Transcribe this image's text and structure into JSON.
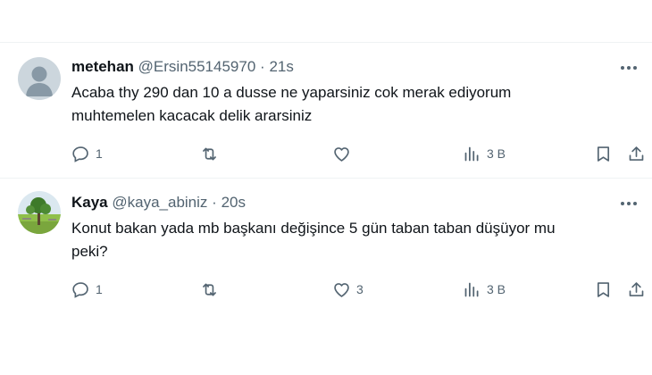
{
  "tweets": [
    {
      "name": "metehan",
      "handle": "@Ersin55145970",
      "separator": "·",
      "time": "21s",
      "text_line1": "Acaba thy 290 dan 10 a dusse ne yaparsiniz cok merak ediyorum",
      "text_line2": "muhtemelen kacacak delik ararsiniz",
      "reply_count": "1",
      "retweet_count": "",
      "like_count": "",
      "view_count": "3 B",
      "avatar": "default-avatar-icon"
    },
    {
      "name": "Kaya",
      "handle": "@kaya_abiniz",
      "separator": "·",
      "time": "20s",
      "text_line1": "Konut bakan yada mb başkanı değişince 5 gün taban taban düşüyor mu",
      "text_line2": "peki?",
      "reply_count": "1",
      "retweet_count": "",
      "like_count": "3",
      "view_count": "3 B",
      "avatar": "park-photo-avatar"
    }
  ],
  "colors": {
    "text": "#0f1419",
    "secondary": "#536471",
    "divider": "#eff3f4"
  }
}
